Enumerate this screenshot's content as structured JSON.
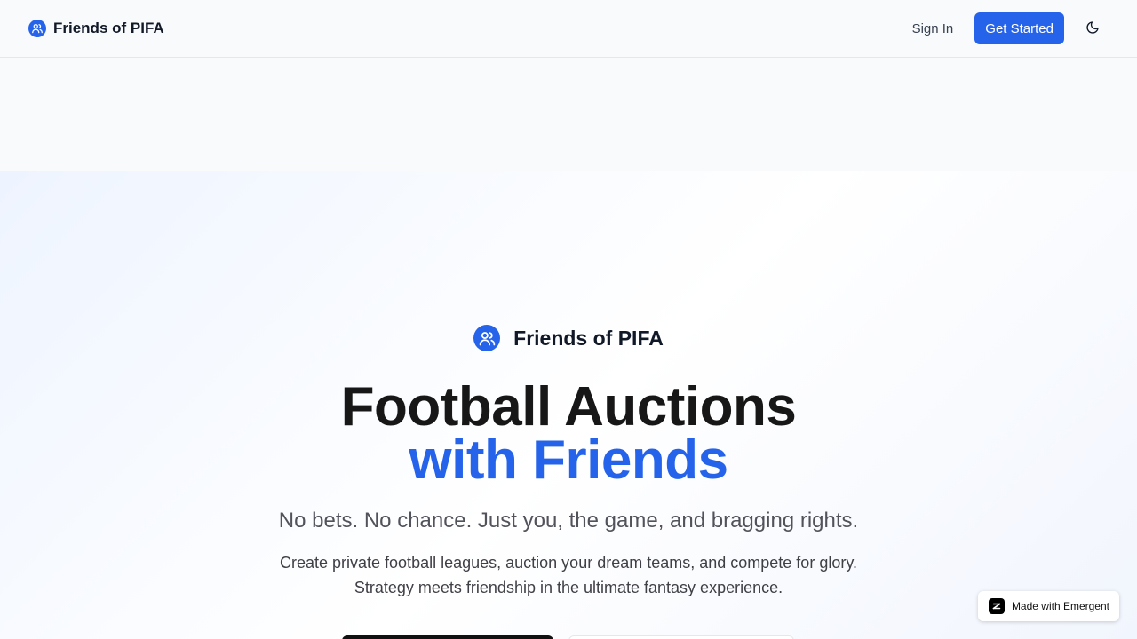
{
  "header": {
    "brand_name": "Friends of PIFA",
    "sign_in_label": "Sign In",
    "get_started_label": "Get Started"
  },
  "hero": {
    "brand_name": "Friends of PIFA",
    "headline_line1": "Football Auctions",
    "headline_line2": "with Friends",
    "tagline": "No bets. No chance. Just you, the game, and bragging rights.",
    "description": "Create private football leagues, auction your dream teams, and compete for glory. Strategy meets friendship in the ultimate fantasy experience."
  },
  "badge": {
    "label": "Made with Emergent"
  },
  "icons": {
    "brand": "users-icon",
    "theme_toggle": "moon-icon",
    "badge_logo": "emergent-logo-icon"
  },
  "colors": {
    "accent": "#2563eb",
    "heading": "#171717",
    "page_background": "#f8fafc"
  }
}
